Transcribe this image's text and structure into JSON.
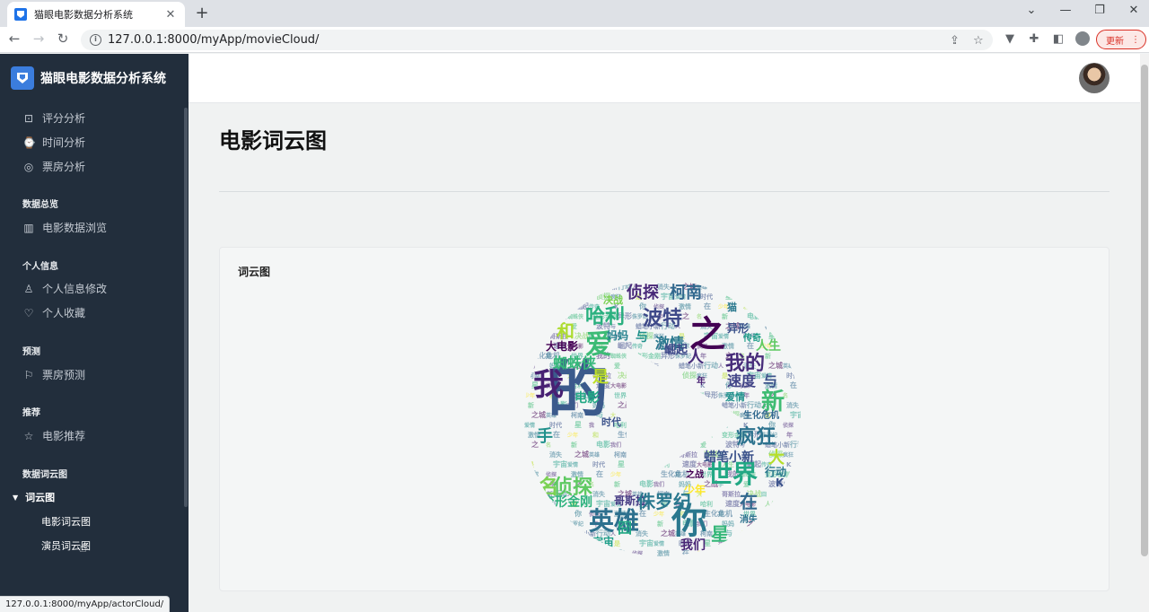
{
  "browser": {
    "tab_title": "猫眼电影数据分析系统",
    "tab_close": "✕",
    "new_tab": "+",
    "url": "127.0.0.1:8000/myApp/movieCloud/",
    "update_label": "更新",
    "status_url": "127.0.0.1:8000/myApp/actorCloud/"
  },
  "sidebar": {
    "brand": "猫眼电影数据分析系统",
    "items": [
      {
        "label": "评分分析",
        "icon": "cast-icon"
      },
      {
        "label": "时间分析",
        "icon": "watch-icon"
      },
      {
        "label": "票房分析",
        "icon": "lifebuoy-icon"
      }
    ],
    "sections": [
      {
        "header": "数据总览",
        "items": [
          {
            "label": "电影数据浏览",
            "icon": "layout-icon"
          }
        ]
      },
      {
        "header": "个人信息",
        "items": [
          {
            "label": "个人信息修改",
            "icon": "user-icon"
          },
          {
            "label": "个人收藏",
            "icon": "heart-icon"
          }
        ]
      },
      {
        "header": "预测",
        "items": [
          {
            "label": "票房预测",
            "icon": "flag-icon"
          }
        ]
      },
      {
        "header": "推荐",
        "items": [
          {
            "label": "电影推荐",
            "icon": "star-icon"
          }
        ]
      },
      {
        "header": "数据词云图",
        "items": []
      }
    ],
    "active_group": "词云图",
    "sub_items": [
      "电影词云图",
      "演员词云图"
    ]
  },
  "main": {
    "page_title": "电影词云图",
    "card_title": "词云图"
  },
  "wordcloud": {
    "words": [
      {
        "t": "的",
        "c": "#3b5a8c"
      },
      {
        "t": "之",
        "c": "#440154"
      },
      {
        "t": "我",
        "c": "#482173"
      },
      {
        "t": "爱",
        "c": "#3cbb75"
      },
      {
        "t": "你",
        "c": "#2a788e"
      },
      {
        "t": "英雄",
        "c": "#2d708e"
      },
      {
        "t": "世界",
        "c": "#22a884"
      },
      {
        "t": "侦探",
        "c": "#5ec962"
      },
      {
        "t": "名",
        "c": "#7ad151"
      },
      {
        "t": "哈利",
        "c": "#2ab07f"
      },
      {
        "t": "波特",
        "c": "#3e4989"
      },
      {
        "t": "侦探",
        "c": "#482878"
      },
      {
        "t": "柯南",
        "c": "#31688e"
      },
      {
        "t": "我的",
        "c": "#472c7a"
      },
      {
        "t": "疯狂",
        "c": "#2c728e"
      },
      {
        "t": "新",
        "c": "#3fbc73"
      },
      {
        "t": "速度",
        "c": "#414487"
      },
      {
        "t": "与",
        "c": "#3b528b"
      },
      {
        "t": "激情",
        "c": "#2a788e"
      },
      {
        "t": "与",
        "c": "#21918c"
      },
      {
        "t": "蜘蛛侠",
        "c": "#35b779"
      },
      {
        "t": "是",
        "c": "#bddf26"
      },
      {
        "t": "电影",
        "c": "#22a884"
      },
      {
        "t": "大电影",
        "c": "#440154"
      },
      {
        "t": "蜡笔小新",
        "c": "#3b528b"
      },
      {
        "t": "在",
        "c": "#31688e"
      },
      {
        "t": "大",
        "c": "#b5de2b"
      },
      {
        "t": "变形金刚",
        "c": "#2db27d"
      },
      {
        "t": "宇宙",
        "c": "#1f9e89"
      },
      {
        "t": "我们",
        "c": "#482475"
      },
      {
        "t": "人生",
        "c": "#5ec962"
      },
      {
        "t": "行动",
        "c": "#2a788e"
      },
      {
        "t": "少年",
        "c": "#fde725"
      },
      {
        "t": "哥斯拉",
        "c": "#443983"
      },
      {
        "t": "异形",
        "c": "#3b528b"
      },
      {
        "t": "爱情",
        "c": "#21918c"
      },
      {
        "t": "妈妈",
        "c": "#26828e"
      },
      {
        "t": "崛起",
        "c": "#3e4989"
      },
      {
        "t": "人",
        "c": "#472d7b"
      },
      {
        "t": "和",
        "c": "#addc30"
      },
      {
        "t": "决战",
        "c": "#7ad151"
      },
      {
        "t": "侏罗纪",
        "c": "#2a788e"
      },
      {
        "t": "时代",
        "c": "#3b528b"
      },
      {
        "t": "之战",
        "c": "#440154"
      },
      {
        "t": "传奇",
        "c": "#1f9e89"
      },
      {
        "t": "消失",
        "c": "#2c728e"
      },
      {
        "t": "生化危机",
        "c": "#31688e"
      },
      {
        "t": "囧",
        "c": "#22a884"
      },
      {
        "t": "年",
        "c": "#482173"
      },
      {
        "t": "星",
        "c": "#35b779"
      },
      {
        "t": "手",
        "c": "#21918c"
      },
      {
        "t": "K",
        "c": "#3b528b"
      },
      {
        "t": "之城",
        "c": "#440154"
      },
      {
        "t": "猫",
        "c": "#2a788e"
      }
    ]
  }
}
